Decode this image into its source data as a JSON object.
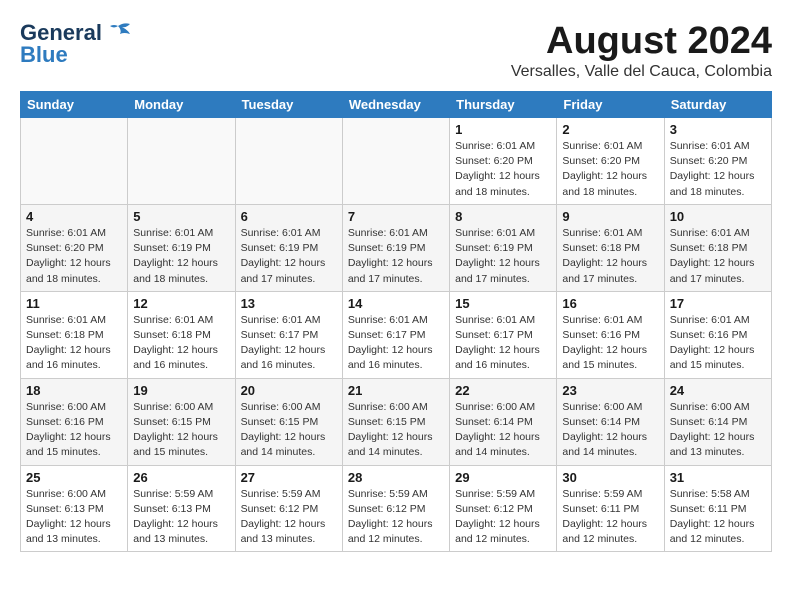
{
  "header": {
    "logo_line1": "General",
    "logo_line2": "Blue",
    "title": "August 2024",
    "subtitle": "Versalles, Valle del Cauca, Colombia"
  },
  "weekdays": [
    "Sunday",
    "Monday",
    "Tuesday",
    "Wednesday",
    "Thursday",
    "Friday",
    "Saturday"
  ],
  "weeks": [
    [
      {
        "day": "",
        "detail": ""
      },
      {
        "day": "",
        "detail": ""
      },
      {
        "day": "",
        "detail": ""
      },
      {
        "day": "",
        "detail": ""
      },
      {
        "day": "1",
        "detail": "Sunrise: 6:01 AM\nSunset: 6:20 PM\nDaylight: 12 hours\nand 18 minutes."
      },
      {
        "day": "2",
        "detail": "Sunrise: 6:01 AM\nSunset: 6:20 PM\nDaylight: 12 hours\nand 18 minutes."
      },
      {
        "day": "3",
        "detail": "Sunrise: 6:01 AM\nSunset: 6:20 PM\nDaylight: 12 hours\nand 18 minutes."
      }
    ],
    [
      {
        "day": "4",
        "detail": "Sunrise: 6:01 AM\nSunset: 6:20 PM\nDaylight: 12 hours\nand 18 minutes."
      },
      {
        "day": "5",
        "detail": "Sunrise: 6:01 AM\nSunset: 6:19 PM\nDaylight: 12 hours\nand 18 minutes."
      },
      {
        "day": "6",
        "detail": "Sunrise: 6:01 AM\nSunset: 6:19 PM\nDaylight: 12 hours\nand 17 minutes."
      },
      {
        "day": "7",
        "detail": "Sunrise: 6:01 AM\nSunset: 6:19 PM\nDaylight: 12 hours\nand 17 minutes."
      },
      {
        "day": "8",
        "detail": "Sunrise: 6:01 AM\nSunset: 6:19 PM\nDaylight: 12 hours\nand 17 minutes."
      },
      {
        "day": "9",
        "detail": "Sunrise: 6:01 AM\nSunset: 6:18 PM\nDaylight: 12 hours\nand 17 minutes."
      },
      {
        "day": "10",
        "detail": "Sunrise: 6:01 AM\nSunset: 6:18 PM\nDaylight: 12 hours\nand 17 minutes."
      }
    ],
    [
      {
        "day": "11",
        "detail": "Sunrise: 6:01 AM\nSunset: 6:18 PM\nDaylight: 12 hours\nand 16 minutes."
      },
      {
        "day": "12",
        "detail": "Sunrise: 6:01 AM\nSunset: 6:18 PM\nDaylight: 12 hours\nand 16 minutes."
      },
      {
        "day": "13",
        "detail": "Sunrise: 6:01 AM\nSunset: 6:17 PM\nDaylight: 12 hours\nand 16 minutes."
      },
      {
        "day": "14",
        "detail": "Sunrise: 6:01 AM\nSunset: 6:17 PM\nDaylight: 12 hours\nand 16 minutes."
      },
      {
        "day": "15",
        "detail": "Sunrise: 6:01 AM\nSunset: 6:17 PM\nDaylight: 12 hours\nand 16 minutes."
      },
      {
        "day": "16",
        "detail": "Sunrise: 6:01 AM\nSunset: 6:16 PM\nDaylight: 12 hours\nand 15 minutes."
      },
      {
        "day": "17",
        "detail": "Sunrise: 6:01 AM\nSunset: 6:16 PM\nDaylight: 12 hours\nand 15 minutes."
      }
    ],
    [
      {
        "day": "18",
        "detail": "Sunrise: 6:00 AM\nSunset: 6:16 PM\nDaylight: 12 hours\nand 15 minutes."
      },
      {
        "day": "19",
        "detail": "Sunrise: 6:00 AM\nSunset: 6:15 PM\nDaylight: 12 hours\nand 15 minutes."
      },
      {
        "day": "20",
        "detail": "Sunrise: 6:00 AM\nSunset: 6:15 PM\nDaylight: 12 hours\nand 14 minutes."
      },
      {
        "day": "21",
        "detail": "Sunrise: 6:00 AM\nSunset: 6:15 PM\nDaylight: 12 hours\nand 14 minutes."
      },
      {
        "day": "22",
        "detail": "Sunrise: 6:00 AM\nSunset: 6:14 PM\nDaylight: 12 hours\nand 14 minutes."
      },
      {
        "day": "23",
        "detail": "Sunrise: 6:00 AM\nSunset: 6:14 PM\nDaylight: 12 hours\nand 14 minutes."
      },
      {
        "day": "24",
        "detail": "Sunrise: 6:00 AM\nSunset: 6:14 PM\nDaylight: 12 hours\nand 13 minutes."
      }
    ],
    [
      {
        "day": "25",
        "detail": "Sunrise: 6:00 AM\nSunset: 6:13 PM\nDaylight: 12 hours\nand 13 minutes."
      },
      {
        "day": "26",
        "detail": "Sunrise: 5:59 AM\nSunset: 6:13 PM\nDaylight: 12 hours\nand 13 minutes."
      },
      {
        "day": "27",
        "detail": "Sunrise: 5:59 AM\nSunset: 6:12 PM\nDaylight: 12 hours\nand 13 minutes."
      },
      {
        "day": "28",
        "detail": "Sunrise: 5:59 AM\nSunset: 6:12 PM\nDaylight: 12 hours\nand 12 minutes."
      },
      {
        "day": "29",
        "detail": "Sunrise: 5:59 AM\nSunset: 6:12 PM\nDaylight: 12 hours\nand 12 minutes."
      },
      {
        "day": "30",
        "detail": "Sunrise: 5:59 AM\nSunset: 6:11 PM\nDaylight: 12 hours\nand 12 minutes."
      },
      {
        "day": "31",
        "detail": "Sunrise: 5:58 AM\nSunset: 6:11 PM\nDaylight: 12 hours\nand 12 minutes."
      }
    ]
  ]
}
